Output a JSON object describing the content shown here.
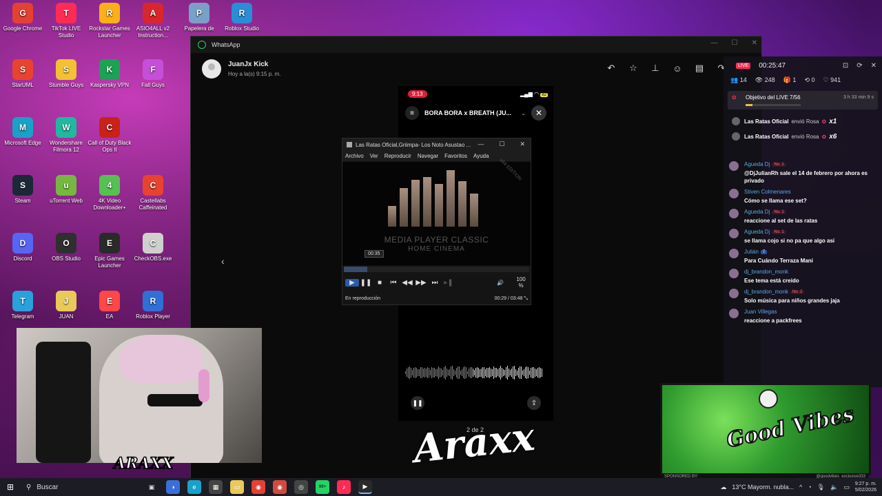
{
  "desktop_icons": [
    {
      "label": "Google Chrome",
      "icon": "chrome-icon",
      "color": "#e34133"
    },
    {
      "label": "TikTok LIVE Studio",
      "icon": "tiktok-icon",
      "color": "#fe2c55"
    },
    {
      "label": "Rockstar Games Launcher",
      "icon": "rockstar-icon",
      "color": "#fcaf17"
    },
    {
      "label": "ASIO4ALL v2 Instruction...",
      "icon": "pdf-icon",
      "color": "#d9262c"
    },
    {
      "label": "Papelera de",
      "icon": "recycle-bin-icon",
      "color": "#7aa0c8"
    },
    {
      "label": "Roblox Studio",
      "icon": "roblox-studio-icon",
      "color": "#2a8dd6"
    },
    {
      "label": "StarUML",
      "icon": "staruml-icon",
      "color": "#e8432e"
    },
    {
      "label": "Stumble Guys",
      "icon": "stumble-guys-icon",
      "color": "#f2c230"
    },
    {
      "label": "Kaspersky VPN",
      "icon": "kaspersky-icon",
      "color": "#1aa352"
    },
    {
      "label": "Fall Guys",
      "icon": "fall-guys-icon",
      "color": "#c64fd8"
    },
    {
      "label": "Microsoft Edge",
      "icon": "edge-icon",
      "color": "#1aa1c8"
    },
    {
      "label": "Wondershare Filmora 12",
      "icon": "filmora-icon",
      "color": "#1fb8a0"
    },
    {
      "label": "Call of Duty Black Ops II",
      "icon": "cod-icon",
      "color": "#c8221b"
    },
    {
      "label": "Steam",
      "icon": "steam-icon",
      "color": "#1b2838"
    },
    {
      "label": "uTorrent Web",
      "icon": "utorrent-icon",
      "color": "#76b83f"
    },
    {
      "label": "4K Video Downloader+",
      "icon": "4k-video-icon",
      "color": "#55c152"
    },
    {
      "label": "Castellabs Caffeinated",
      "icon": "castlabs-icon",
      "color": "#e8432e"
    },
    {
      "label": "Discord",
      "icon": "discord-icon",
      "color": "#5865f2"
    },
    {
      "label": "OBS Studio",
      "icon": "obs-icon",
      "color": "#302e31"
    },
    {
      "label": "Epic Games Launcher",
      "icon": "epic-icon",
      "color": "#2a2a2a"
    },
    {
      "label": "CheckOBS.exe",
      "icon": "checkobs-icon",
      "color": "#cfcfcf"
    },
    {
      "label": "Telegram",
      "icon": "telegram-icon",
      "color": "#2aa1da"
    },
    {
      "label": "JUAN",
      "icon": "folder-icon",
      "color": "#e9c95a"
    },
    {
      "label": "EA",
      "icon": "ea-icon",
      "color": "#ff4747"
    },
    {
      "label": "Roblox Player",
      "icon": "roblox-player-icon",
      "color": "#2f6fd6"
    }
  ],
  "whatsapp": {
    "app_title": "WhatsApp",
    "contact_name": "JuanJx Kick",
    "contact_time": "Hoy a la(s) 9:15 p. m.",
    "counter": "2 de 2",
    "actions": [
      "reply-icon",
      "star-icon",
      "pin-icon",
      "emoji-icon",
      "delete-icon",
      "forward-icon"
    ]
  },
  "phone": {
    "time": "9:13",
    "battery": "82",
    "track_title": "BORA BORA x BREATH (JU..."
  },
  "mpc": {
    "title": "Las Ratas Oficial,Griimpa- Los Noto Asustao ...",
    "menu": [
      "Archivo",
      "Ver",
      "Reproducir",
      "Navegar",
      "Favoritos",
      "Ayuda"
    ],
    "logo_line1": "MEDIA PLAYER CLASSIC",
    "logo_line2": "HOME CINEMA",
    "edition": "x64 EDITION",
    "tooltip": "00:35",
    "volume": "100 %",
    "status": "En reproducción",
    "time": "00:29 / 03:48",
    "progress": 0.127
  },
  "live": {
    "badge": "LIVE",
    "timer": "00:25:47",
    "stats": {
      "viewers": "14",
      "views": "248",
      "gifts": "1",
      "shares": "0",
      "likes": "941"
    },
    "goal": {
      "label": "Objetivo del LIVE 7/56",
      "time": "3 h 33 min 9 s",
      "progress": 0.125
    },
    "gifts": [
      {
        "user": "Las Ratas Oficial",
        "action": "envió Rosa",
        "count": "x1"
      },
      {
        "user": "Las Ratas Oficial",
        "action": "envió Rosa",
        "count": "x6"
      }
    ],
    "chat": [
      {
        "user": "Agueda Dj",
        "badge": "No. 1",
        "text": "@DjJulianRh sale el 14 de febrero por ahora es privado"
      },
      {
        "user": "Stiven Colmenares",
        "badge": "",
        "text": "Cómo se llama ese set?"
      },
      {
        "user": "Agueda Dj",
        "badge": "No. 1",
        "text": "reaccione al set de las ratas"
      },
      {
        "user": "Agueda Dj",
        "badge": "No. 1",
        "text": "se llama cojo si no pa que algo asi"
      },
      {
        "user": "Julián",
        "badge": "7",
        "text": "Para Cuándo Terraza Mani"
      },
      {
        "user": "dj_brandon_monk",
        "badge": "",
        "text": "Ese tema está creído"
      },
      {
        "user": "dj_brandon_monk",
        "badge": "No. 2",
        "text": "Solo música para niños grandes jaja"
      },
      {
        "user": "Juan Villegas",
        "badge": "",
        "text": "reaccione a packfrees"
      }
    ]
  },
  "goodvibes": {
    "logo": "Good Vibes",
    "sponsored": "SPONSORED BY:",
    "handle": "@goodvibes_exclusive333"
  },
  "stream": {
    "brand": "ARAXX",
    "signature": "Araxx"
  },
  "taskbar": {
    "search_placeholder": "Buscar",
    "weather": "13°C  Mayorm. nubla...",
    "time": "9:27 p. m.",
    "date": "5/02/2026",
    "badge": "99+"
  }
}
